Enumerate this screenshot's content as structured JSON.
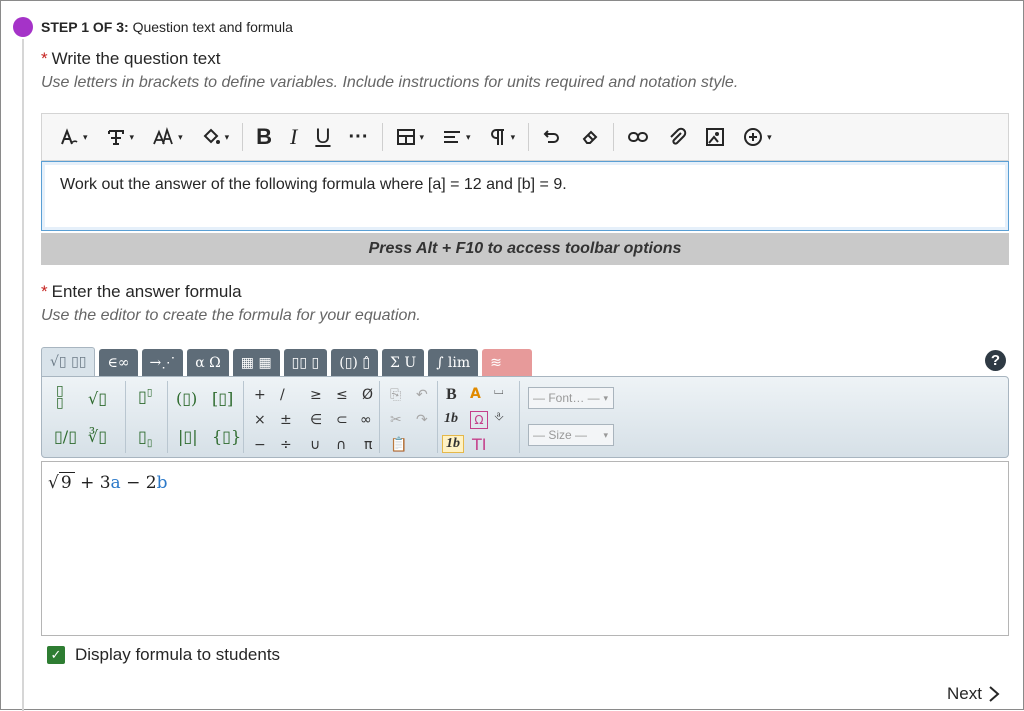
{
  "step": {
    "prefix": "STEP 1 OF 3:",
    "title": "Question text and formula"
  },
  "question_field": {
    "required_mark": "*",
    "label": "Write the question text",
    "hint": "Use letters in brackets to define variables. Include instructions for units required and notation style.",
    "content": "Work out the answer of the following formula where [a] = 12 and [b] = 9.",
    "status": "Press Alt + F10 to access toolbar options"
  },
  "toolbar": {
    "icons": [
      "paragraph-style-icon",
      "text-format-icon",
      "font-size-icon",
      "fill-color-icon",
      "bold-icon",
      "italic-icon",
      "underline-icon",
      "more-icon",
      "table-icon",
      "align-icon",
      "paragraph-icon",
      "undo-icon",
      "eraser-icon",
      "link-icon",
      "attach-icon",
      "image-icon",
      "insert-icon"
    ]
  },
  "formula_field": {
    "required_mark": "*",
    "label": "Enter the answer formula",
    "hint": "Use the editor to create the formula for your equation.",
    "tabs": [
      "√▯ ▯▯",
      "∈∞",
      "→⋰",
      "α Ω",
      "▦ ▦",
      "▯▯ ▯",
      "(▯) ▯̂",
      "Σ U",
      "∫ lim",
      "≋"
    ],
    "font_select": "— Font… —",
    "size_select": "— Size —",
    "formula": {
      "radicand": "9",
      "plus": "+ 3",
      "var_a": "a",
      "minus": "− 2",
      "var_b": "b"
    },
    "accent_color": "#2b79c9"
  },
  "display_checkbox": {
    "checked": true,
    "label": "Display formula to students"
  },
  "next_label": "Next"
}
